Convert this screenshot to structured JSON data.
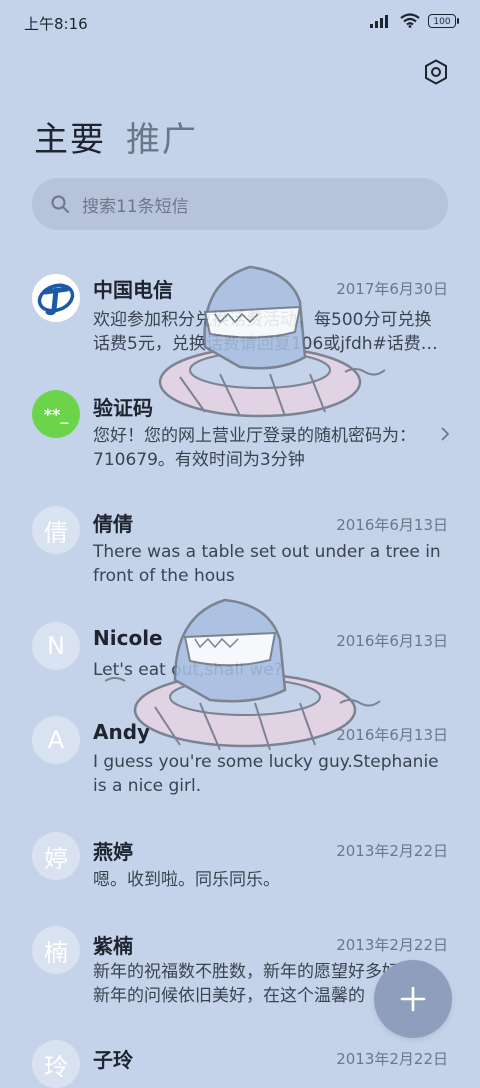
{
  "status_bar": {
    "time": "上午8:16",
    "battery": "100"
  },
  "tabs": [
    {
      "label": "主要"
    },
    {
      "label": "推广"
    }
  ],
  "search": {
    "placeholder": "搜索11条短信"
  },
  "conversations": [
    {
      "avatar": "",
      "name": "中国电信",
      "date": "2017年6月30日",
      "preview": "欢迎参加积分兑换话费活动，每500分可兑换话费5元，兑换话费请回复106或jfdh#话费…"
    },
    {
      "avatar": "**_",
      "name": "验证码",
      "date": "",
      "preview": "您好！您的网上营业厅登录的随机密码为：710679。有效时间为3分钟"
    },
    {
      "avatar": "倩",
      "name": "倩倩",
      "date": "2016年6月13日",
      "preview": "There was a table set out under a tree in front of the hous"
    },
    {
      "avatar": "N",
      "name": "Nicole",
      "date": "2016年6月13日",
      "preview": "Let's eat out,shall we?"
    },
    {
      "avatar": "A",
      "name": "Andy",
      "date": "2016年6月13日",
      "preview": "I guess you're some lucky guy.Stephanie is a nice girl."
    },
    {
      "avatar": "婷",
      "name": "燕婷",
      "date": "2013年2月22日",
      "preview": "嗯。收到啦。同乐同乐。"
    },
    {
      "avatar": "楠",
      "name": "紫楠",
      "date": "2013年2月22日",
      "preview": "新年的祝福数不胜数，新年的愿望好多好多，新年的问候依旧美好，在这个温馨的"
    },
    {
      "avatar": "玲",
      "name": "子玲",
      "date": "2013年2月22日",
      "preview": ""
    }
  ],
  "colors": {
    "background": "#c5d3ea",
    "verify_avatar": "#6cd44a",
    "telecom_blue": "#1a5aa8",
    "fab": "#8e9fbd"
  },
  "icons": {
    "settings": "settings-hexagon-icon",
    "search": "search-icon",
    "fab": "plus-icon"
  }
}
